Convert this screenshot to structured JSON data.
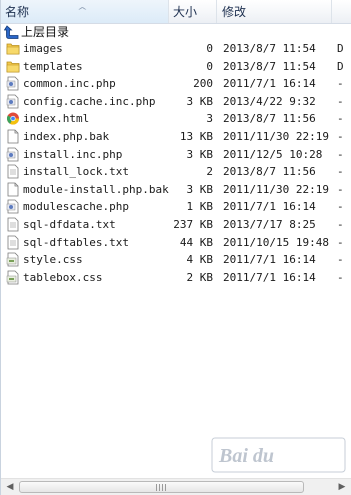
{
  "header": {
    "name": "名称",
    "size": "大小",
    "date": "修改",
    "extra": "",
    "sort_arrow": "^"
  },
  "up_row": {
    "label": "上层目录",
    "icon": "up-arrow-icon"
  },
  "files": [
    {
      "name": "images",
      "size": "0",
      "date": "2013/8/7 11:54",
      "extra": "D",
      "icon": "folder-icon"
    },
    {
      "name": "templates",
      "size": "0",
      "date": "2013/8/7 11:54",
      "extra": "D",
      "icon": "folder-icon"
    },
    {
      "name": "common.inc.php",
      "size": "200",
      "date": "2011/7/1 16:14",
      "extra": "-",
      "icon": "php-file-icon"
    },
    {
      "name": "config.cache.inc.php",
      "size": "3 KB",
      "date": "2013/4/22 9:32",
      "extra": "-",
      "icon": "php-file-icon"
    },
    {
      "name": "index.html",
      "size": "3",
      "date": "2013/8/7 11:56",
      "extra": "-",
      "icon": "chrome-html-icon"
    },
    {
      "name": "index.php.bak",
      "size": "13 KB",
      "date": "2011/11/30 22:19",
      "extra": "-",
      "icon": "blank-file-icon"
    },
    {
      "name": "install.inc.php",
      "size": "3 KB",
      "date": "2011/12/5 10:28",
      "extra": "-",
      "icon": "php-file-icon"
    },
    {
      "name": "install_lock.txt",
      "size": "2",
      "date": "2013/8/7 11:56",
      "extra": "-",
      "icon": "text-file-icon"
    },
    {
      "name": "module-install.php.bak",
      "size": "3 KB",
      "date": "2011/11/30 22:19",
      "extra": "-",
      "icon": "blank-file-icon"
    },
    {
      "name": "modulescache.php",
      "size": "1 KB",
      "date": "2011/7/1 16:14",
      "extra": "-",
      "icon": "php-file-icon"
    },
    {
      "name": "sql-dfdata.txt",
      "size": "237 KB",
      "date": "2013/7/17 8:25",
      "extra": "-",
      "icon": "text-file-icon"
    },
    {
      "name": "sql-dftables.txt",
      "size": "44 KB",
      "date": "2011/10/15 19:48",
      "extra": "-",
      "icon": "text-file-icon"
    },
    {
      "name": "style.css",
      "size": "4 KB",
      "date": "2011/7/1 16:14",
      "extra": "-",
      "icon": "css-file-icon"
    },
    {
      "name": "tablebox.css",
      "size": "2 KB",
      "date": "2011/7/1 16:14",
      "extra": "-",
      "icon": "css-file-icon"
    }
  ],
  "watermark": {
    "text": "Bai du",
    "paw": "🐾"
  },
  "scrollbar": {
    "left": "◀",
    "right": "▶"
  }
}
